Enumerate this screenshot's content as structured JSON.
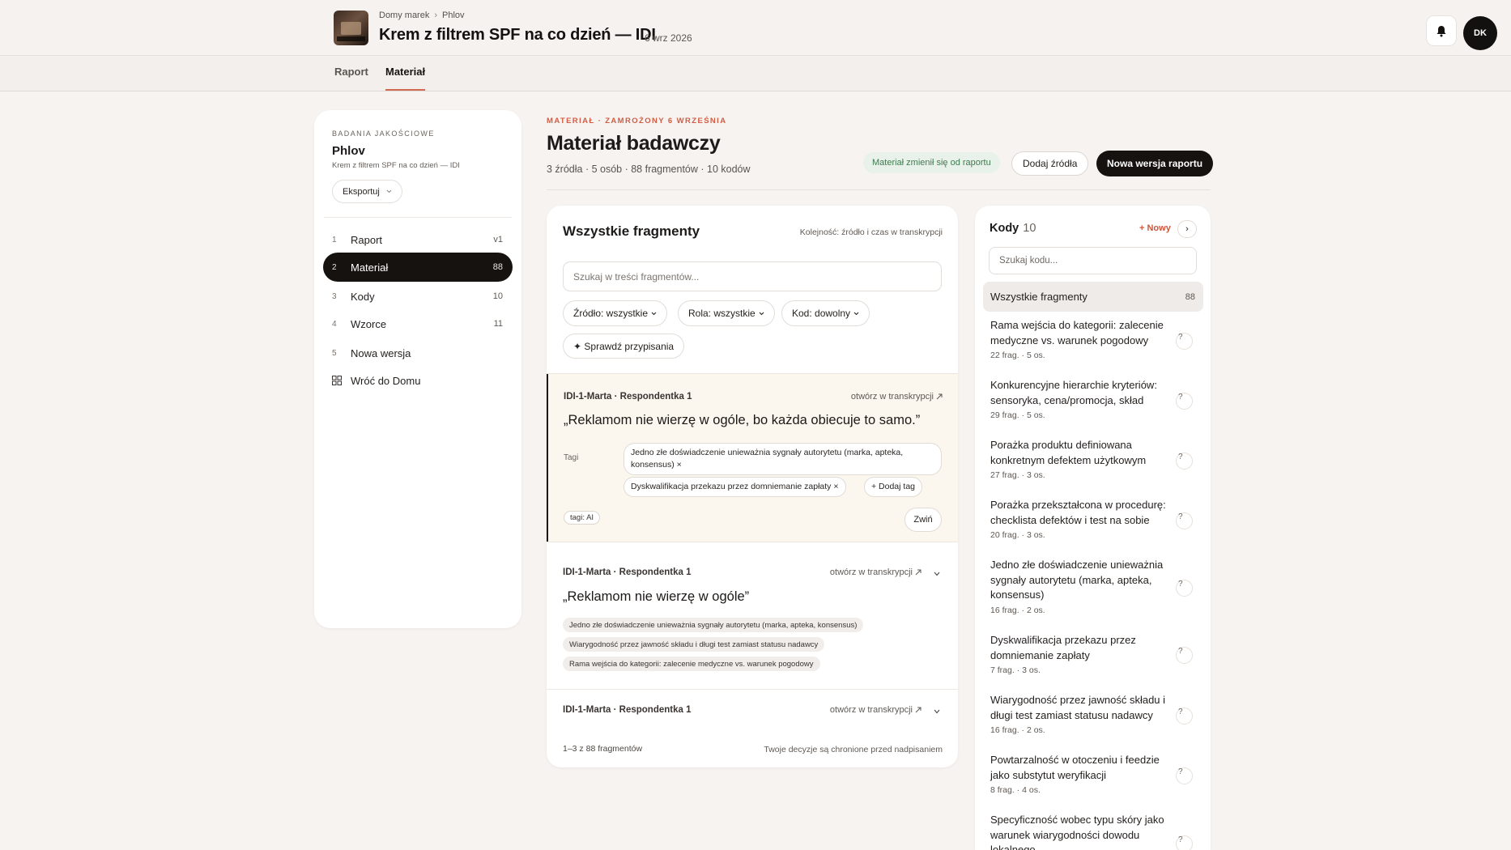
{
  "header": {
    "breadcrumbs": [
      "Domy marek",
      "Phlov"
    ],
    "breadcrumb_sep": "›",
    "title": "Krem z filtrem SPF na co dzień — IDI",
    "date": "6 wrz 2026",
    "avatar_initials": "DK"
  },
  "tabs": [
    {
      "label": "Raport",
      "active": false
    },
    {
      "label": "Materiał",
      "active": true
    }
  ],
  "sidebar": {
    "kicker": "BADANIA JAKOŚCIOWE",
    "name": "Phlov",
    "subtitle": "Krem z filtrem SPF na co dzień — IDI",
    "export_label": "Eksportuj",
    "items": [
      {
        "num": "1",
        "label": "Raport",
        "count": "v1",
        "active": false
      },
      {
        "num": "2",
        "label": "Materiał",
        "count": "88",
        "active": true
      },
      {
        "num": "3",
        "label": "Kody",
        "count": "10",
        "active": false
      },
      {
        "num": "4",
        "label": "Wzorce",
        "count": "11",
        "active": false
      },
      {
        "num": "5",
        "label": "Nowa wersja",
        "count": "",
        "active": false
      }
    ],
    "back_label": "Wróć do Domu"
  },
  "main": {
    "kicker": "MATERIAŁ · ZAMROŻONY 6 WRZEŚNIA",
    "title": "Materiał badawczy",
    "stats": "3 źródła · 5 osób · 88 fragmentów · 10 kodów",
    "changed_badge": "Materiał zmienił się od raportu",
    "add_sources": "Dodaj źródła",
    "new_version": "Nowa wersja raportu"
  },
  "fragments": {
    "title": "Wszystkie fragmenty",
    "order": "Kolejność: źródło i czas w transkrypcji",
    "search_placeholder": "Szukaj w treści fragmentów...",
    "filters": [
      "Źródło: wszystkie",
      "Rola: wszystkie",
      "Kod: dowolny"
    ],
    "check_label": "✦ Sprawdź przypisania",
    "open_link": "otwórz w transkrypcji",
    "items": [
      {
        "source": "IDI-1-Marta · Respondentka 1",
        "quote": "„Reklamom nie wierzę w ogóle, bo każda obiecuje to samo.”",
        "tags_label": "Tagi",
        "tags": [
          "Jedno złe doświadczenie unieważnia sygnały autorytetu (marka, apteka, konsensus) ×",
          "Dyskwalifikacja przekazu przez domniemanie zapłaty ×"
        ],
        "add_tag": "+ Dodaj tag",
        "ai_chip": "tagi: AI",
        "collapse": "Zwiń"
      },
      {
        "source": "IDI-1-Marta · Respondentka 1",
        "quote": "„Reklamom nie wierzę w ogóle”",
        "tags": [
          "Jedno złe doświadczenie unieważnia sygnały autorytetu (marka, apteka, konsensus)",
          "Wiarygodność przez jawność składu i długi test zamiast statusu nadawcy",
          "Rama wejścia do kategorii: zalecenie medyczne vs. warunek pogodowy"
        ]
      },
      {
        "source": "IDI-1-Marta · Respondentka 1"
      }
    ],
    "pager": "1–3 z 88 fragmentów",
    "protected": "Twoje decyzje są chronione przed nadpisaniem"
  },
  "codes": {
    "title": "Kody",
    "count": "10",
    "new_label": "+ Nowy",
    "next": "›",
    "search_placeholder": "Szukaj kodu...",
    "all_label": "Wszystkie fragmenty",
    "all_count": "88",
    "items": [
      {
        "title": "Rama wejścia do kategorii: zalecenie medyczne vs. warunek pogodowy",
        "meta": "22 frag. · 5 os."
      },
      {
        "title": "Konkurencyjne hierarchie kryteriów: sensoryka, cena/promocja, skład",
        "meta": "29 frag. · 5 os."
      },
      {
        "title": "Porażka produktu definiowana konkretnym defektem użytkowym",
        "meta": "27 frag. · 3 os."
      },
      {
        "title": "Porażka przekształcona w procedurę: checklista defektów i test na sobie",
        "meta": "20 frag. · 3 os."
      },
      {
        "title": "Jedno złe doświadczenie unieważnia sygnały autorytetu (marka, apteka, konsensus)",
        "meta": "16 frag. · 2 os."
      },
      {
        "title": "Dyskwalifikacja przekazu przez domniemanie zapłaty",
        "meta": "7 frag. · 3 os."
      },
      {
        "title": "Wiarygodność przez jawność składu i długi test zamiast statusu nadawcy",
        "meta": "16 frag. · 2 os."
      },
      {
        "title": "Powtarzalność w otoczeniu i feedzie jako substytut weryfikacji",
        "meta": "8 frag. · 4 os."
      },
      {
        "title": "Specyficzność wobec typu skóry jako warunek wiarygodności dowodu lokalnego",
        "meta": ""
      }
    ],
    "q_mark": "?"
  },
  "colors": {
    "accent": "#cf5d45",
    "dark": "#16120f",
    "success_bg": "#e8f2ea",
    "success_text": "#3f7a4e"
  }
}
